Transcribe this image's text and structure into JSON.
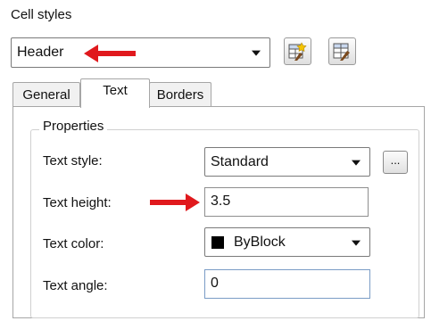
{
  "cell_styles": {
    "label": "Cell styles",
    "selected": "Header",
    "new_style_icon": "new-table-style-icon",
    "modify_style_icon": "modify-table-style-icon"
  },
  "tabs": [
    {
      "label": "General",
      "active": false
    },
    {
      "label": "Text",
      "active": true
    },
    {
      "label": "Borders",
      "active": false
    }
  ],
  "properties": {
    "title": "Properties",
    "text_style": {
      "label": "Text style:",
      "value": "Standard",
      "browse": "..."
    },
    "text_height": {
      "label": "Text height:",
      "value": "3.5"
    },
    "text_color": {
      "label": "Text color:",
      "value": "ByBlock",
      "swatch": "#000000"
    },
    "text_angle": {
      "label": "Text angle:",
      "value": "0"
    }
  },
  "annotations": {
    "arrow_color": "#e0191d"
  }
}
